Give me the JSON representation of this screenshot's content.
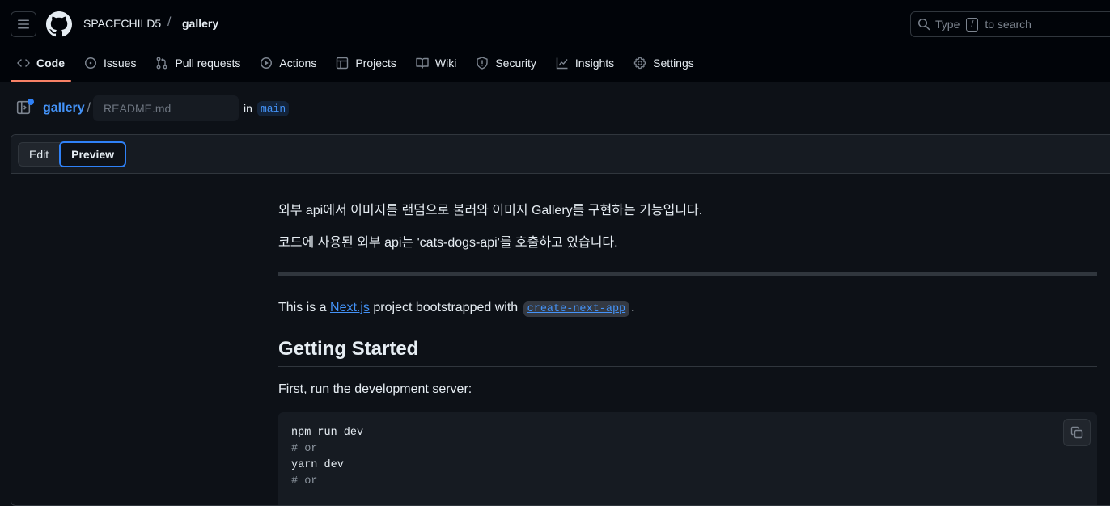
{
  "header": {
    "owner": "SPACECHILD5",
    "separator": "/",
    "repo": "gallery",
    "search": {
      "before": "Type",
      "key": "/",
      "after": "to search"
    }
  },
  "nav": {
    "items": [
      {
        "label": "Code",
        "icon": "code-icon",
        "active": true
      },
      {
        "label": "Issues",
        "icon": "issue-icon"
      },
      {
        "label": "Pull requests",
        "icon": "pull-request-icon"
      },
      {
        "label": "Actions",
        "icon": "play-icon"
      },
      {
        "label": "Projects",
        "icon": "table-icon"
      },
      {
        "label": "Wiki",
        "icon": "book-icon"
      },
      {
        "label": "Security",
        "icon": "shield-icon"
      },
      {
        "label": "Insights",
        "icon": "graph-icon"
      },
      {
        "label": "Settings",
        "icon": "gear-icon"
      }
    ]
  },
  "path": {
    "repo_link": "gallery",
    "slash": "/",
    "filename_placeholder": "README.md",
    "in_label": "in",
    "branch": "main"
  },
  "editor": {
    "tab_edit": "Edit",
    "tab_preview": "Preview"
  },
  "preview": {
    "line1": "외부 api에서 이미지를 랜덤으로 불러와 이미지 Gallery를 구현하는 기능입니다.",
    "line2": "코드에 사용된 외부 api는 'cats-dogs-api'를 호출하고 있습니다.",
    "intro_prefix": "This is a",
    "intro_link": "Next.js",
    "intro_middle": "project bootstrapped with",
    "intro_code": "create-next-app",
    "intro_suffix": ".",
    "heading": "Getting Started",
    "run_text": "First, run the development server:",
    "code_lines": [
      {
        "text": "npm run dev",
        "comment": false
      },
      {
        "text": "# or",
        "comment": true
      },
      {
        "text": "yarn dev",
        "comment": false
      },
      {
        "text": "# or",
        "comment": true
      }
    ]
  },
  "colors": {
    "accent": "#4493f8",
    "active_tab_underline": "#f78166",
    "background": "#0d1117"
  }
}
